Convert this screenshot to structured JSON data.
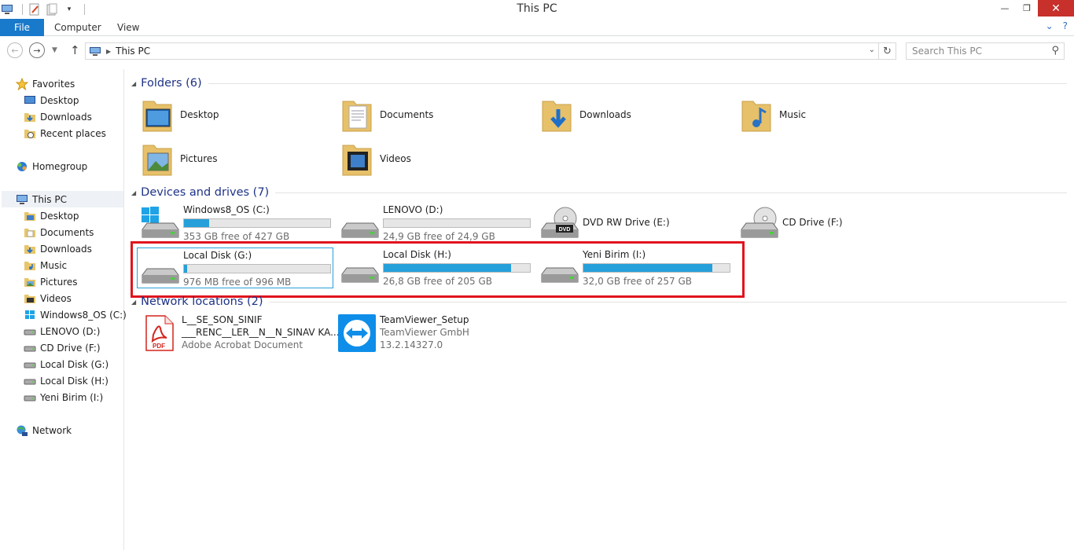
{
  "window": {
    "title": "This PC"
  },
  "ribbon": {
    "file": "File",
    "tabs": [
      "Computer",
      "View"
    ]
  },
  "address": {
    "path": "This PC",
    "search_placeholder": "Search This PC"
  },
  "nav": {
    "favorites": "Favorites",
    "fav_items": [
      "Desktop",
      "Downloads",
      "Recent places"
    ],
    "homegroup": "Homegroup",
    "thispc": "This PC",
    "pc_items": [
      "Desktop",
      "Documents",
      "Downloads",
      "Music",
      "Pictures",
      "Videos",
      "Windows8_OS (C:)",
      "LENOVO (D:)",
      "CD Drive (F:)",
      "Local Disk (G:)",
      "Local Disk (H:)",
      "Yeni Birim (I:)"
    ],
    "network": "Network"
  },
  "folders": {
    "title": "Folders (6)",
    "items": [
      "Desktop",
      "Documents",
      "Downloads",
      "Music",
      "Pictures",
      "Videos"
    ]
  },
  "devices": {
    "title": "Devices and drives (7)",
    "drives": [
      {
        "name": "Windows8_OS (C:)",
        "free": "353 GB free of 427 GB",
        "used_fraction": 0.17
      },
      {
        "name": "LENOVO (D:)",
        "free": "24,9 GB free of 24,9 GB",
        "used_fraction": 0.0
      },
      {
        "name": "DVD RW Drive (E:)"
      },
      {
        "name": "CD Drive (F:)"
      },
      {
        "name": "Local Disk (G:)",
        "free": "976 MB free of 996 MB",
        "used_fraction": 0.02
      },
      {
        "name": "Local Disk (H:)",
        "free": "26,8 GB free of 205 GB",
        "used_fraction": 0.87
      },
      {
        "name": "Yeni Birim (I:)",
        "free": "32,0 GB free of 257 GB",
        "used_fraction": 0.88
      }
    ]
  },
  "network_locations": {
    "title": "Network locations (2)",
    "items": [
      {
        "line1": "L__SE_SON_SINIF",
        "line2": "___RENC__LER__N__N_SINAV KA...",
        "line3": "Adobe Acrobat Document",
        "badge": "PDF"
      },
      {
        "line1": "TeamViewer_Setup",
        "line2": "TeamViewer GmbH",
        "line3": "13.2.14327.0"
      }
    ]
  },
  "colors": {
    "accent": "#1979ca",
    "bar_fill": "#26a0da",
    "highlight_box": "#e0141e",
    "group_title": "#1e3287"
  }
}
